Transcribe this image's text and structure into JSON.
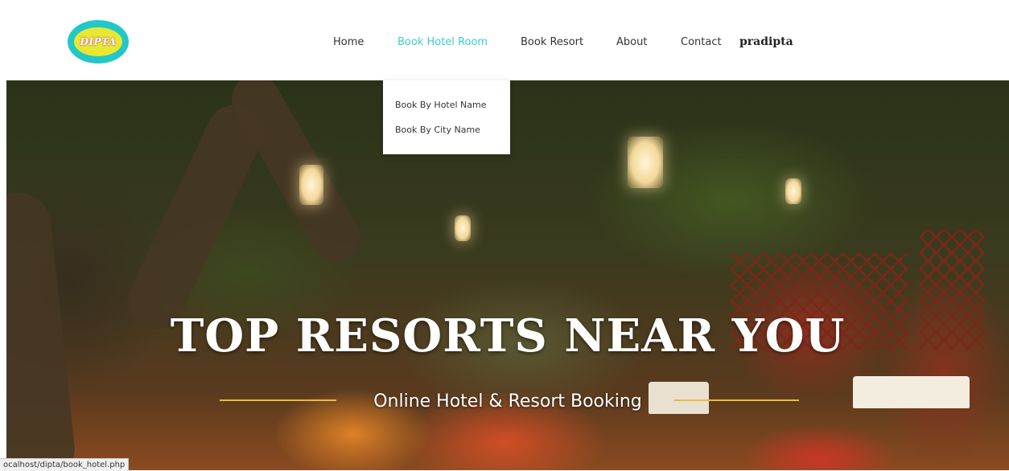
{
  "header": {
    "logo_text": "DIPTA",
    "nav": [
      {
        "label": "Home"
      },
      {
        "label": "Book Hotel Room",
        "active": true
      },
      {
        "label": "Book Resort"
      },
      {
        "label": "About"
      },
      {
        "label": "Contact"
      }
    ],
    "user_name": "pradipta"
  },
  "dropdown": {
    "items": [
      {
        "label": "Book By Hotel Name"
      },
      {
        "label": "Book By City Name"
      }
    ]
  },
  "hero": {
    "title": "TOP RESORTS NEAR YOU",
    "subtitle": "Online Hotel & Resort Booking"
  },
  "status_bar": {
    "url": "ocalhost/dipta/book_hotel.php"
  },
  "colors": {
    "accent": "#3ccfc6",
    "logo_outer": "#22c8c8",
    "logo_inner": "#e8e830",
    "hero_line": "#e8b84a"
  }
}
